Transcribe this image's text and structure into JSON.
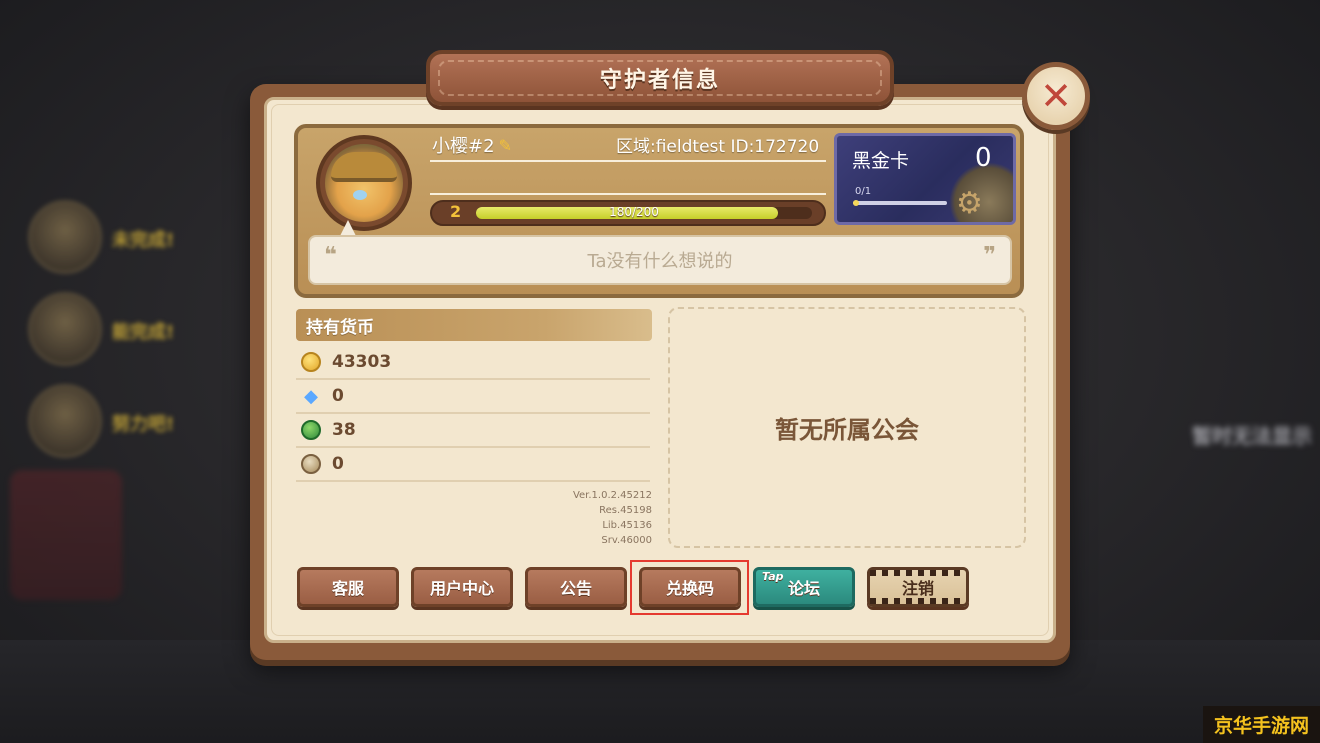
{
  "dialog": {
    "title": "守护者信息",
    "close_icon": "close-icon"
  },
  "profile": {
    "name": "小樱#2",
    "edit_icon": "pencil-icon",
    "region_id": "区域:fieldtest ID:172720",
    "level": "2",
    "xp_text": "180/200",
    "xp_fraction": 0.9,
    "motto": "Ta没有什么想说的",
    "quote_open": "❝",
    "quote_close": "❞"
  },
  "card": {
    "name": "黑金卡",
    "count": "0",
    "progress_text": "0/1",
    "progress_fraction": 0.0
  },
  "currency": {
    "title": "持有货币",
    "items": [
      {
        "icon": "gold-coin-icon",
        "value": "43303"
      },
      {
        "icon": "diamond-icon",
        "value": "0"
      },
      {
        "icon": "green-orb-icon",
        "value": "38"
      },
      {
        "icon": "egg-icon",
        "value": "0"
      }
    ]
  },
  "version": {
    "ver": "Ver.1.0.2.45212",
    "res": "Res.45198",
    "lib": "Lib.45136",
    "srv": "Srv.46000"
  },
  "guild": {
    "text": "暂无所属公会"
  },
  "buttons": {
    "support": "客服",
    "user_center": "用户中心",
    "notice": "公告",
    "redeem": "兑换码",
    "tap_mark": "Tap",
    "forum": "论坛",
    "logout": "注销"
  },
  "background": {
    "side_labels": [
      "未完成!",
      "能完成!",
      "努力吧!"
    ],
    "right_label": "暂时无法显示"
  },
  "watermark": "京华手游网",
  "colors": {
    "frame": "#8a5a3a",
    "paper": "#f3e7cf",
    "highlight": "#e53a2f",
    "tap_green": "#2b8a7e"
  }
}
